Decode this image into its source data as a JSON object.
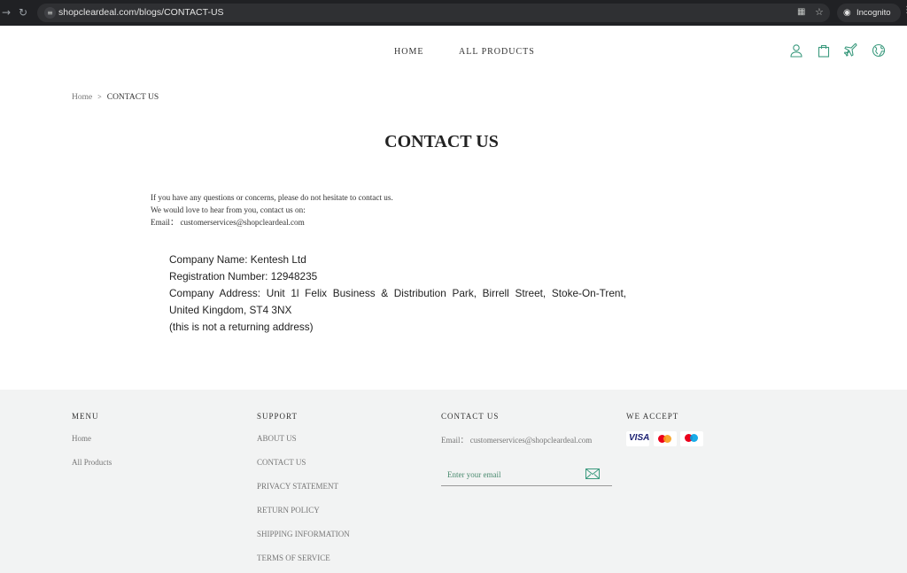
{
  "browser": {
    "url": "shopcleardeal.com/blogs/CONTACT-US",
    "mode_label": "Incognito"
  },
  "header": {
    "nav": [
      {
        "label": "HOME"
      },
      {
        "label": "ALL PRODUCTS"
      }
    ],
    "icons": [
      "user-icon",
      "shopping-bag-icon",
      "airplane-icon",
      "globe-icon"
    ],
    "icon_color": "#3b9a7e"
  },
  "breadcrumb": {
    "home": "Home",
    "separator": ">",
    "current": "CONTACT US"
  },
  "page": {
    "title": "CONTACT US",
    "intro_line1": "If you have any questions or concerns, please do not hesitate to contact us.",
    "intro_line2": "We would love to hear from you, contact us on:",
    "intro_email_label": "Email：",
    "intro_email": "customerservices@shopcleardeal.com",
    "company_name": "Company Name: Kentesh Ltd",
    "registration": "Registration Number: 12948235",
    "address_line1": "Company Address: Unit 1l Felix Business & Distribution Park, Birrell Street, Stoke-On-Trent,",
    "address_line2": "United Kingdom, ST4 3NX",
    "note": "(this is not a returning address)"
  },
  "footer": {
    "menu": {
      "heading": "MENU",
      "links": [
        "Home",
        "All Products"
      ]
    },
    "support": {
      "heading": "SUPPORT",
      "links": [
        "ABOUT US",
        "CONTACT US",
        "PRIVACY STATEMENT",
        "RETURN POLICY",
        "SHIPPING INFORMATION",
        "TERMS OF SERVICE"
      ]
    },
    "contact": {
      "heading": "CONTACT US",
      "email_label": "Email：",
      "email": "customerservices@shopcleardeal.com",
      "subscribe_placeholder": "Enter your email"
    },
    "accept": {
      "heading": "WE ACCEPT",
      "cards": [
        "VISA",
        "Mastercard",
        "Maestro"
      ]
    }
  }
}
